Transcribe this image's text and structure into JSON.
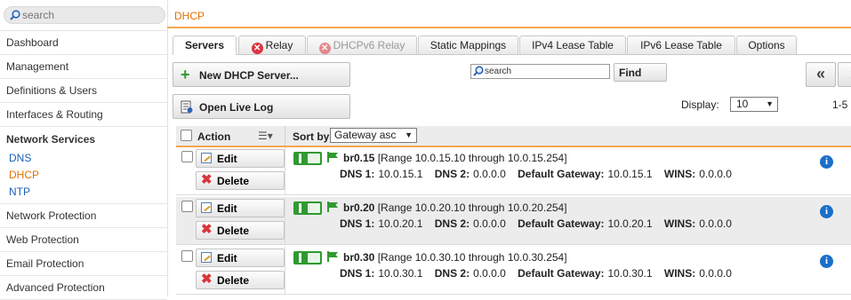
{
  "sidebar": {
    "search_placeholder": "search",
    "items_top": [
      "Dashboard",
      "Management",
      "Definitions & Users",
      "Interfaces & Routing"
    ],
    "group": {
      "title": "Network Services",
      "subs": [
        "DNS",
        "DHCP",
        "NTP"
      ],
      "active": "DHCP"
    },
    "items_bottom": [
      "Network Protection",
      "Web Protection",
      "Email Protection",
      "Advanced Protection"
    ]
  },
  "page": {
    "title": "DHCP"
  },
  "tabs": [
    {
      "label": "Servers"
    },
    {
      "label": "Relay"
    },
    {
      "label": "DHCPv6 Relay"
    },
    {
      "label": "Static Mappings"
    },
    {
      "label": "IPv4 Lease Table"
    },
    {
      "label": "IPv6 Lease Table"
    },
    {
      "label": "Options"
    }
  ],
  "toolbar": {
    "new_label": "New DHCP Server...",
    "log_label": "Open Live Log",
    "filter_value": "search",
    "find_label": "Find",
    "prev_glyph": "«",
    "next_glyph": "›",
    "display_label": "Display:",
    "display_value": "10",
    "range_text": "1-5"
  },
  "table": {
    "action_header": "Action",
    "sortby_label": "Sort by:",
    "sort_value": "Gateway asc",
    "edit_label": "Edit",
    "delete_label": "Delete",
    "dns1_label": "DNS 1:",
    "dns2_label": "DNS 2:",
    "gw_label": "Default Gateway:",
    "wins_label": "WINS:",
    "rows": [
      {
        "name": "br0.15",
        "range": "[Range 10.0.15.10 through 10.0.15.254]",
        "dns1": "10.0.15.1",
        "dns2": "0.0.0.0",
        "gateway": "10.0.15.1",
        "wins": "0.0.0.0"
      },
      {
        "name": "br0.20",
        "range": "[Range 10.0.20.10 through 10.0.20.254]",
        "dns1": "10.0.20.1",
        "dns2": "0.0.0.0",
        "gateway": "10.0.20.1",
        "wins": "0.0.0.0"
      },
      {
        "name": "br0.30",
        "range": "[Range 10.0.30.10 through 10.0.30.254]",
        "dns1": "10.0.30.1",
        "dns2": "0.0.0.0",
        "gateway": "10.0.30.1",
        "wins": "0.0.0.0"
      }
    ]
  },
  "colors": {
    "accent": "#e07000",
    "link": "#1a5fb4",
    "enabled": "#2f9a2f",
    "delete": "#d9363e",
    "info": "#1a6fc9"
  }
}
